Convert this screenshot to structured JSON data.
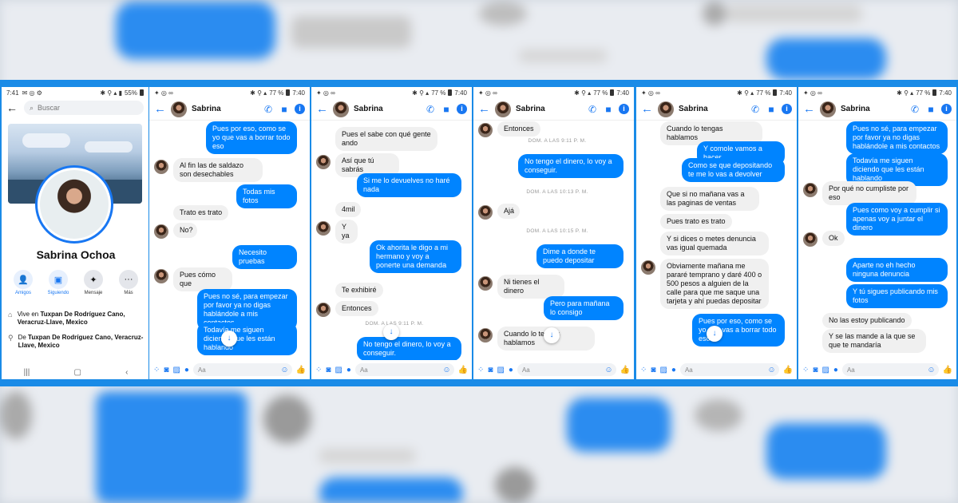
{
  "profile": {
    "status_time": "7:41",
    "status_battery": "55%",
    "search_placeholder": "Buscar",
    "name": "Sabrina Ochoa",
    "actions": [
      {
        "label": "Amigos",
        "icon": "friends-icon"
      },
      {
        "label": "Siguiendo",
        "icon": "following-icon"
      },
      {
        "label": "Mensaje",
        "icon": "messenger-icon"
      },
      {
        "label": "Más",
        "icon": "more-icon"
      }
    ],
    "info": [
      {
        "prefix": "Vive en ",
        "value": "Tuxpan De Rodríguez Cano, Veracruz-Llave, Mexico",
        "icon": "home-icon"
      },
      {
        "prefix": "De ",
        "value": "Tuxpan De Rodríguez Cano, Veracruz-Llave, Mexico",
        "icon": "location-icon"
      }
    ]
  },
  "chat": {
    "contact": "Sabrina",
    "status_time": "7:40",
    "status_battery": "77 %",
    "composer_placeholder": "Aa"
  },
  "panels": [
    {
      "items": [
        {
          "type": "out",
          "text": "Pues por eso, como se yo que vas a borrar todo eso"
        },
        {
          "type": "in",
          "text": "Al fin las de saldazo son desechables",
          "avatar": true
        },
        {
          "type": "out",
          "text": "Todas mis fotos"
        },
        {
          "type": "in",
          "text": "Trato es trato"
        },
        {
          "type": "in",
          "text": "No?",
          "avatar": true
        },
        {
          "type": "out",
          "text": "Necesito pruebas"
        },
        {
          "type": "in",
          "text": "Pues cómo que",
          "avatar": true
        },
        {
          "type": "out",
          "text": "Pues no sé, para empezar por favor ya no digas hablándole a mis contactos"
        },
        {
          "type": "out",
          "text": "Todavía me siguen diciendo que les están hablando"
        }
      ]
    },
    {
      "items": [
        {
          "type": "in",
          "text": "Pues el sabe con qué gente ando"
        },
        {
          "type": "in",
          "text": "Así que tú sabrás",
          "avatar": true
        },
        {
          "type": "out",
          "text": "Si me lo devuelves no haré nada"
        },
        {
          "type": "in",
          "text": "4mil"
        },
        {
          "type": "in",
          "text": "Y ya",
          "avatar": true
        },
        {
          "type": "out",
          "text": "Ok ahorita le digo a mi hermano y voy a ponerte una demanda"
        },
        {
          "type": "in",
          "text": "Te exhibiré"
        },
        {
          "type": "in",
          "text": "Entonces",
          "avatar": true
        },
        {
          "type": "time",
          "text": "DOM. A LAS 9:11 P. M."
        },
        {
          "type": "out",
          "text": "No tengo el dinero, lo voy a conseguir."
        }
      ]
    },
    {
      "items": [
        {
          "type": "in",
          "text": "Entonces",
          "avatar": true
        },
        {
          "type": "time",
          "text": "DOM. A LAS 9:11 P. M."
        },
        {
          "type": "out",
          "text": "No tengo el dinero, lo voy a conseguir."
        },
        {
          "type": "time",
          "text": "DOM. A LAS 10:13 P. M."
        },
        {
          "type": "in",
          "text": "Ajá",
          "avatar": true
        },
        {
          "type": "time",
          "text": "DOM. A LAS 10:15 P. M."
        },
        {
          "type": "out",
          "text": "Dime a donde te puedo depositar"
        },
        {
          "type": "in",
          "text": "Ni tienes el dinero",
          "avatar": true
        },
        {
          "type": "out",
          "text": "Pero para mañana lo consigo"
        },
        {
          "type": "in",
          "text": "Cuando lo tengas hablamos",
          "avatar": true
        }
      ]
    },
    {
      "items": [
        {
          "type": "in",
          "text": "Cuando lo tengas hablamos"
        },
        {
          "type": "out",
          "text": "Y comole vamos a hacer"
        },
        {
          "type": "out",
          "text": "Como se que depositando te me lo vas a devolver"
        },
        {
          "type": "in",
          "text": "Que si no mañana vas a las paginas de ventas"
        },
        {
          "type": "in",
          "text": "Pues trato es trato"
        },
        {
          "type": "in",
          "text": "Y si dices o metes denuncia vas igual quemada"
        },
        {
          "type": "in",
          "text": "Obviamente mañana me pararé temprano y daré 400 o 500 pesos a alguien de la calle para que me saque una tarjeta y ahí puedas depositar",
          "avatar": true
        },
        {
          "type": "out",
          "text": "Pues por eso, como se yo que vas a borrar todo eso"
        }
      ]
    },
    {
      "items": [
        {
          "type": "out",
          "text": "Pues no sé, para empezar por favor ya no digas hablándole a mis contactos"
        },
        {
          "type": "out",
          "text": "Todavía me siguen diciendo que les están hablando"
        },
        {
          "type": "in",
          "text": "Por qué no cumpliste por eso",
          "avatar": true
        },
        {
          "type": "out",
          "text": "Pues como voy a cumplir si apenas voy a juntar el dinero"
        },
        {
          "type": "in",
          "text": "Ok",
          "avatar": true
        },
        {
          "type": "out",
          "text": "Aparte no eh hecho ninguna denuncia"
        },
        {
          "type": "out",
          "text": "Y tú sigues publicando mis fotos"
        },
        {
          "type": "in",
          "text": "No las estoy publicando"
        },
        {
          "type": "in",
          "text": "Y se las mande a la que se que te mandaría"
        }
      ]
    }
  ]
}
